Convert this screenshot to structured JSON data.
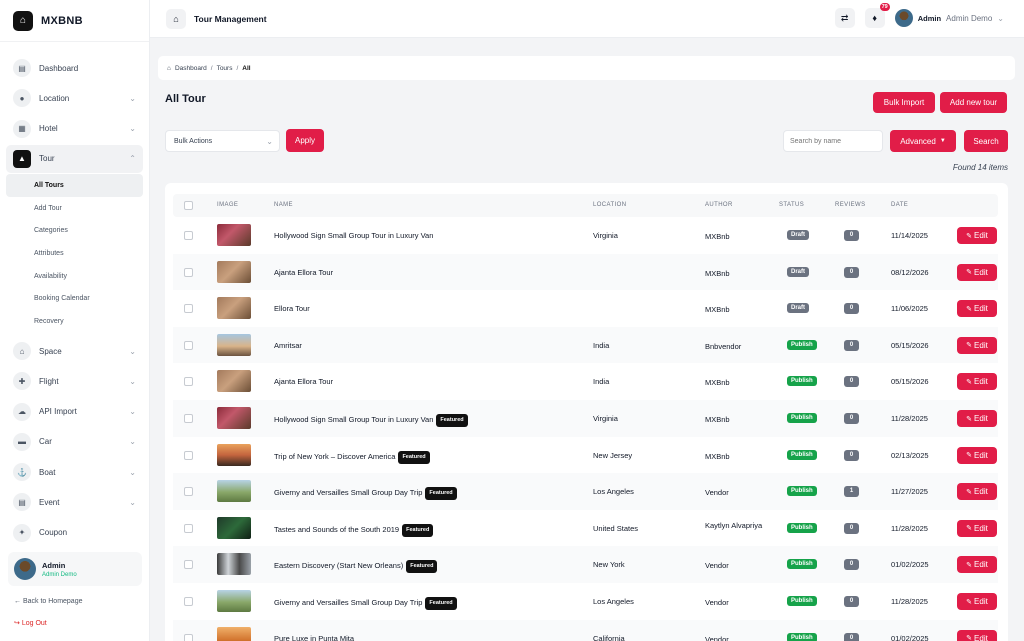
{
  "brand": {
    "name": "MXBNB",
    "logo_icon": "home-icon"
  },
  "sidebar": {
    "items": [
      {
        "label": "Dashboard",
        "icon": "dashboard-icon",
        "chevron": false
      },
      {
        "label": "Location",
        "icon": "location-icon",
        "chevron": true
      },
      {
        "label": "Hotel",
        "icon": "building-icon",
        "chevron": true
      },
      {
        "label": "Tour",
        "icon": "tour-icon",
        "chevron": true,
        "active": true
      }
    ],
    "tour_sub": [
      "All Tours",
      "Add Tour",
      "Categories",
      "Attributes",
      "Availability",
      "Booking Calendar",
      "Recovery"
    ],
    "items_after": [
      {
        "label": "Space",
        "icon": "space-icon"
      },
      {
        "label": "Flight",
        "icon": "flight-icon"
      },
      {
        "label": "API Import",
        "icon": "cloud-icon"
      },
      {
        "label": "Car",
        "icon": "car-icon"
      },
      {
        "label": "Boat",
        "icon": "boat-icon"
      },
      {
        "label": "Event",
        "icon": "event-icon"
      },
      {
        "label": "Coupon",
        "icon": "coupon-icon"
      }
    ],
    "user": {
      "name": "Admin",
      "role": "Admin Demo"
    },
    "back_label": "Back to Homepage",
    "logout_label": "Log Out"
  },
  "topbar": {
    "title": "Tour Management",
    "notif_count": "79",
    "user_name": "Admin",
    "user_role": "Admin Demo"
  },
  "breadcrumb": {
    "home": "Dashboard",
    "tours": "Tours",
    "current": "All"
  },
  "page": {
    "title": "All Tour",
    "bulk_import": "Bulk Import",
    "add_new": "Add new tour",
    "bulk_actions": "Bulk Actions",
    "apply": "Apply",
    "search_placeholder": "Search by name",
    "advanced": "Advanced",
    "search": "Search",
    "found": "Found 14 items"
  },
  "table": {
    "headers": {
      "image": "IMAGE",
      "name": "NAME",
      "location": "LOCATION",
      "author": "AUTHOR",
      "status": "STATUS",
      "reviews": "REVIEWS",
      "date": "DATE"
    },
    "edit_label": "Edit",
    "featured_label": "Featured",
    "rows": [
      {
        "name": "Hollywood Sign Small Group Tour in Luxury Van",
        "featured": false,
        "location": "Virginia",
        "author": "MXBnb",
        "status": "Draft",
        "reviews": "0",
        "date": "11/14/2025",
        "thumb": "warm"
      },
      {
        "name": "Ajanta Ellora Tour",
        "featured": false,
        "location": "",
        "author": "MXBnb",
        "status": "Draft",
        "reviews": "0",
        "date": "08/12/2026",
        "thumb": "cave"
      },
      {
        "name": "Ellora Tour",
        "featured": false,
        "location": "",
        "author": "MXBnb",
        "status": "Draft",
        "reviews": "0",
        "date": "11/06/2025",
        "thumb": "cave"
      },
      {
        "name": "Amritsar",
        "featured": false,
        "location": "India",
        "author": "Bnbvendor",
        "status": "Publish",
        "reviews": "0",
        "date": "05/15/2026",
        "thumb": "city"
      },
      {
        "name": "Ajanta Ellora Tour",
        "featured": false,
        "location": "India",
        "author": "MXBnb",
        "status": "Publish",
        "reviews": "0",
        "date": "05/15/2026",
        "thumb": "cave"
      },
      {
        "name": "Hollywood Sign Small Group Tour in Luxury Van",
        "featured": true,
        "location": "Virginia",
        "author": "MXBnb",
        "status": "Publish",
        "reviews": "0",
        "date": "11/28/2025",
        "thumb": "warm"
      },
      {
        "name": "Trip of New York – Discover America",
        "featured": true,
        "location": "New Jersey",
        "author": "MXBnb",
        "status": "Publish",
        "reviews": "0",
        "date": "02/13/2025",
        "thumb": "sunset"
      },
      {
        "name": "Giverny and Versailles Small Group Day Trip",
        "featured": true,
        "location": "Los Angeles",
        "author": "Vendor",
        "status": "Publish",
        "reviews": "1",
        "date": "11/27/2025",
        "thumb": "green"
      },
      {
        "name": "Tastes and Sounds of the South 2019",
        "featured": true,
        "location": "United States",
        "author": "Kaytlyn Alvapriya",
        "status": "Publish",
        "reviews": "0",
        "date": "11/28/2025",
        "thumb": "dark"
      },
      {
        "name": "Eastern Discovery (Start New Orleans)",
        "featured": true,
        "location": "New York",
        "author": "Vendor",
        "status": "Publish",
        "reviews": "0",
        "date": "01/02/2025",
        "thumb": "mix"
      },
      {
        "name": "Giverny and Versailles Small Group Day Trip",
        "featured": true,
        "location": "Los Angeles",
        "author": "Vendor",
        "status": "Publish",
        "reviews": "0",
        "date": "11/28/2025",
        "thumb": "green"
      },
      {
        "name": "Pure Luxe in Punta Mita",
        "featured": false,
        "location": "California",
        "author": "Vendor",
        "status": "Publish",
        "reviews": "0",
        "date": "01/02/2025",
        "thumb": "orange"
      }
    ]
  },
  "colors": {
    "accent": "#e11d48",
    "publish": "#16a34a",
    "draft": "#6b7280",
    "featured": "#111111"
  }
}
